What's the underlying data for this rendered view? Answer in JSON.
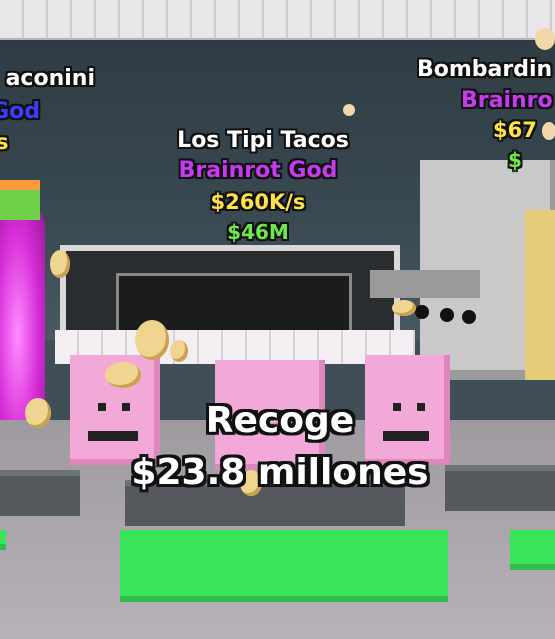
{
  "overhead_labels": [
    {
      "name": "aconini",
      "rarity": "God",
      "rate": "s",
      "price": ""
    },
    {
      "name": "Los Tipi Tacos",
      "rarity": "Brainrot God",
      "rate": "$260K/s",
      "price": "$46M"
    },
    {
      "name": "Bombardin",
      "rarity": "Brainro",
      "rate": "$67",
      "price": "$"
    }
  ],
  "collect": {
    "title": "Recoge",
    "amount": "$23.8 millones"
  },
  "colors": {
    "name_text": "#ffffff",
    "rarity_purple": "#c63bf0",
    "rarity_blue": "#3a3cff",
    "rate_yellow": "#ffe14a",
    "price_green": "#6fe84a",
    "pad_green": "#39e45a"
  }
}
